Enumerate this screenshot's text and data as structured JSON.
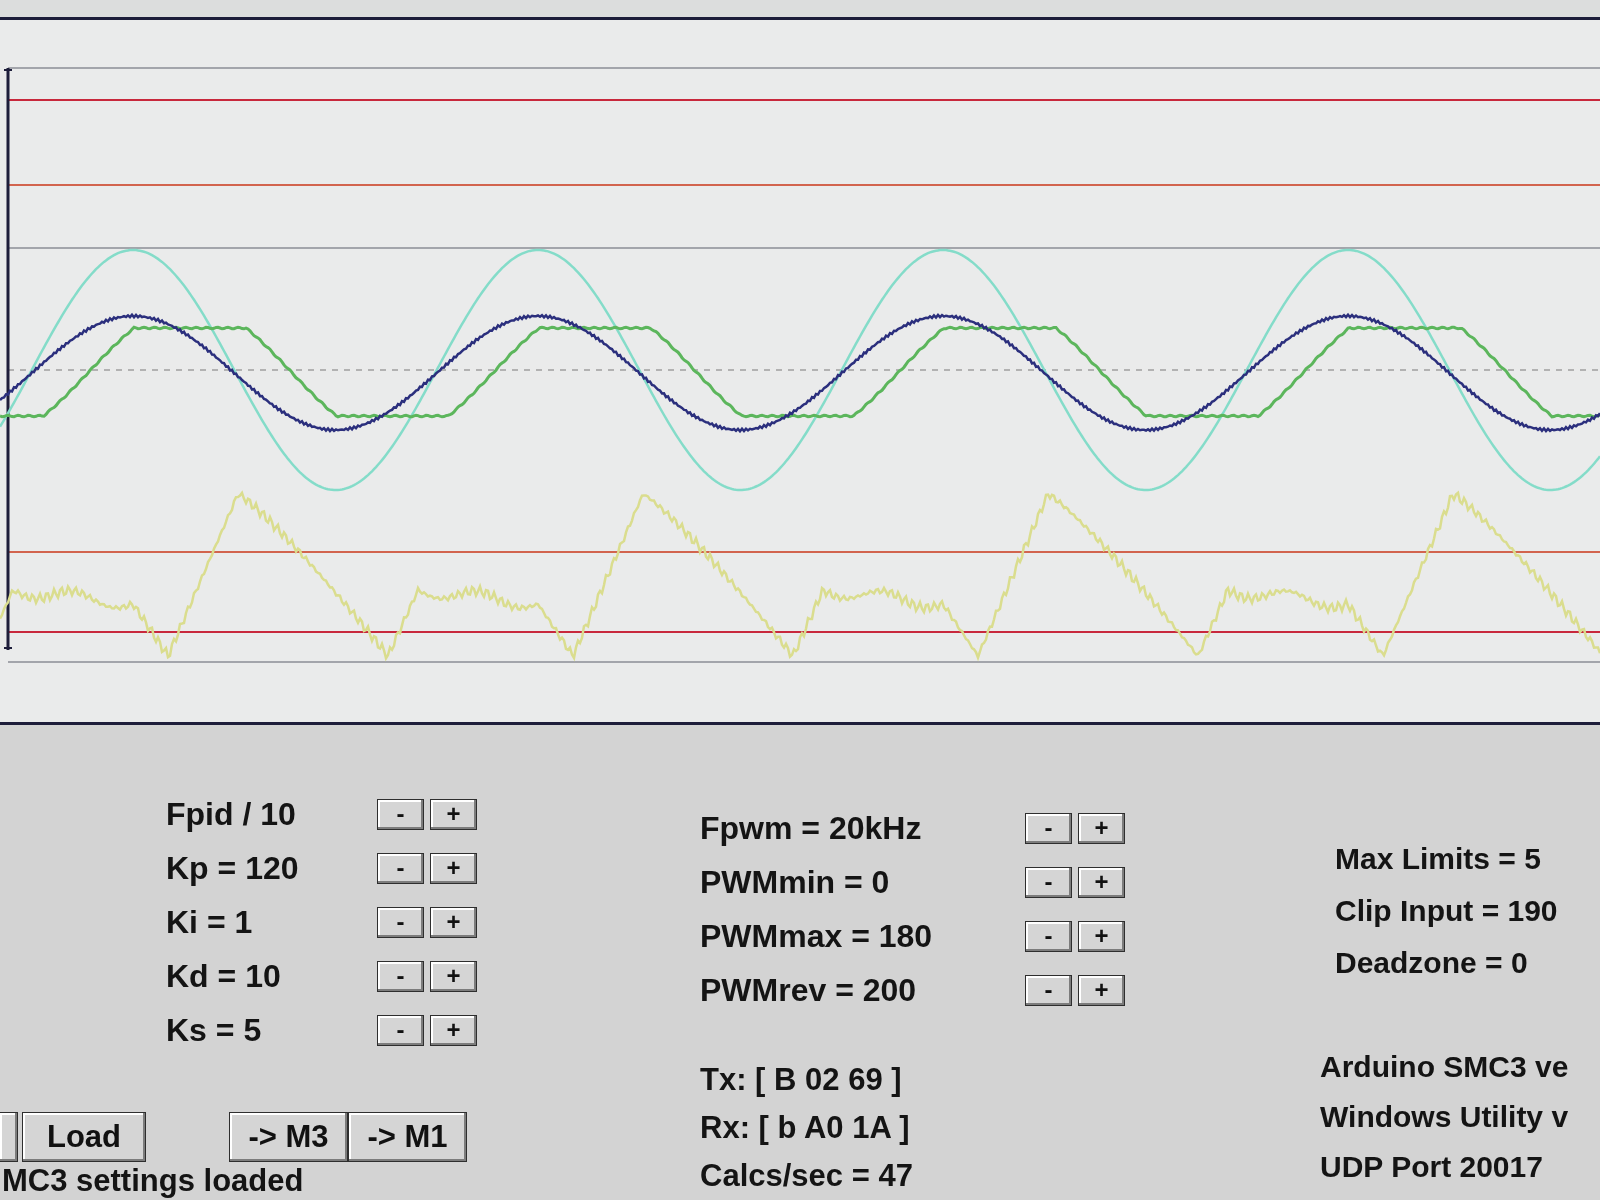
{
  "pid_settings": [
    {
      "label": "Fpid / 10",
      "buttons": [
        "-",
        "+"
      ]
    },
    {
      "label": "Kp = 120",
      "buttons": [
        "-",
        "+"
      ]
    },
    {
      "label": "Ki = 1",
      "buttons": [
        "-",
        "+"
      ]
    },
    {
      "label": "Kd = 10",
      "buttons": [
        "-",
        "+"
      ]
    },
    {
      "label": "Ks = 5",
      "buttons": [
        "-",
        "+"
      ]
    }
  ],
  "file_buttons": [
    "Load"
  ],
  "motor_buttons": [
    "-> M3",
    "-> M1"
  ],
  "status": "MC3 settings loaded",
  "pwm_settings": [
    {
      "label": "Fpwm = 20kHz",
      "buttons": [
        "-",
        "+"
      ]
    },
    {
      "label": "PWMmin = 0",
      "buttons": [
        "-",
        "+"
      ]
    },
    {
      "label": "PWMmax = 180",
      "buttons": [
        "-",
        "+"
      ]
    },
    {
      "label": "PWMrev = 200",
      "buttons": [
        "-",
        "+"
      ]
    }
  ],
  "serial_monitor": [
    "Tx: [ B 02 69 ]",
    "Rx: [ b A0 1A ]",
    "Calcs/sec = 47"
  ],
  "limits": [
    "Max Limits = 5",
    "Clip Input = 190",
    "Deadzone = 0"
  ],
  "about": [
    "Arduino SMC3 ve",
    "Windows Utility v",
    "UDP Port 20017"
  ]
}
